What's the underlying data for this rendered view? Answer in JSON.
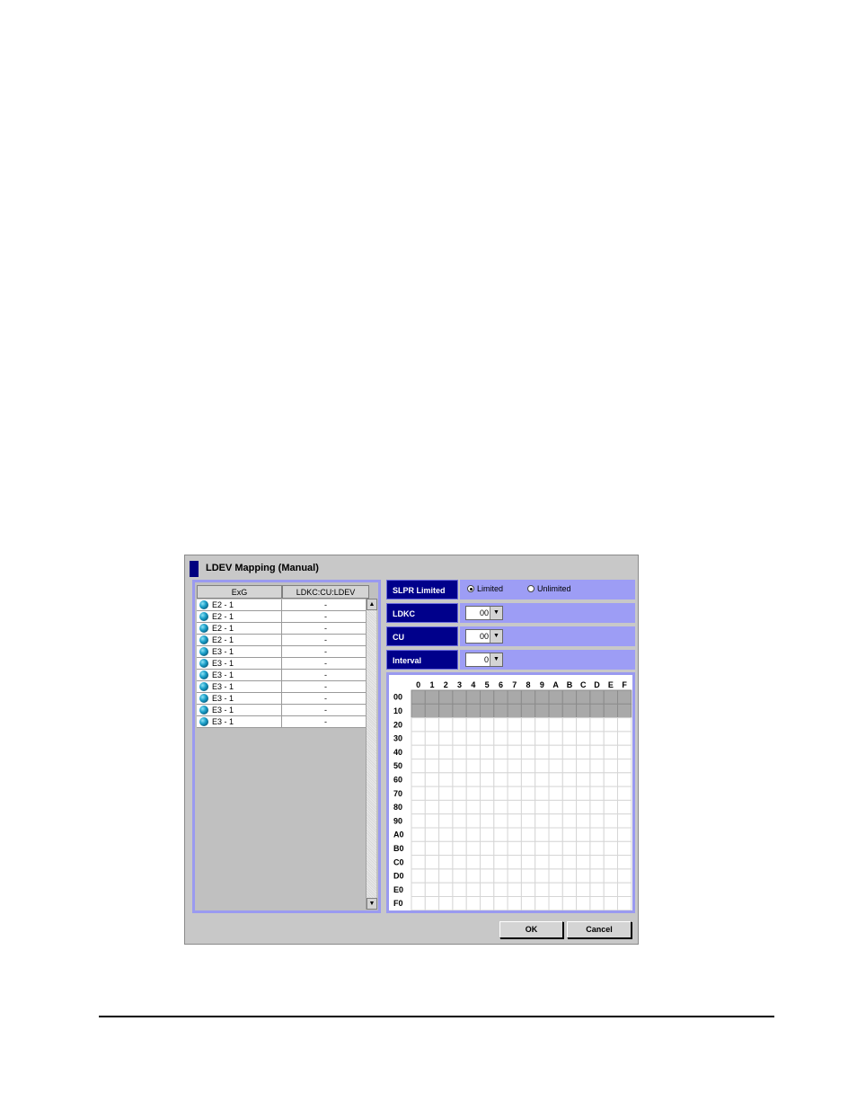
{
  "dialog": {
    "title": "LDEV Mapping (Manual)",
    "ok_label": "OK",
    "cancel_label": "Cancel"
  },
  "table": {
    "columns": [
      "ExG",
      "LDKC:CU:LDEV"
    ],
    "rows": [
      {
        "exg": "E2 - 1",
        "ldev": "-"
      },
      {
        "exg": "E2 - 1",
        "ldev": "-"
      },
      {
        "exg": "E2 - 1",
        "ldev": "-"
      },
      {
        "exg": "E2 - 1",
        "ldev": "-"
      },
      {
        "exg": "E3 - 1",
        "ldev": "-"
      },
      {
        "exg": "E3 - 1",
        "ldev": "-"
      },
      {
        "exg": "E3 - 1",
        "ldev": "-"
      },
      {
        "exg": "E3 - 1",
        "ldev": "-"
      },
      {
        "exg": "E3 - 1",
        "ldev": "-"
      },
      {
        "exg": "E3 - 1",
        "ldev": "-"
      },
      {
        "exg": "E3 - 1",
        "ldev": "-"
      }
    ],
    "icon": "globe-icon"
  },
  "slpr": {
    "label": "SLPR Limited",
    "options": [
      "Limited",
      "Unlimited"
    ],
    "selected": "Limited"
  },
  "ldkc": {
    "label": "LDKC",
    "value": "00"
  },
  "cu": {
    "label": "CU",
    "value": "00"
  },
  "interval": {
    "label": "Interval",
    "value": "0"
  },
  "ldev_grid": {
    "col_headers": [
      "0",
      "1",
      "2",
      "3",
      "4",
      "5",
      "6",
      "7",
      "8",
      "9",
      "A",
      "B",
      "C",
      "D",
      "E",
      "F"
    ],
    "row_headers": [
      "00",
      "10",
      "20",
      "30",
      "40",
      "50",
      "60",
      "70",
      "80",
      "90",
      "A0",
      "B0",
      "C0",
      "D0",
      "E0",
      "F0"
    ],
    "shaded_rows": [
      "00",
      "10"
    ],
    "shaded_color": "#a9a9a9"
  },
  "colors": {
    "label_bg": "#00008b",
    "value_bg": "#9d9df5",
    "panel_border": "#9a9af0",
    "dialog_bg": "#c8c8c8"
  }
}
